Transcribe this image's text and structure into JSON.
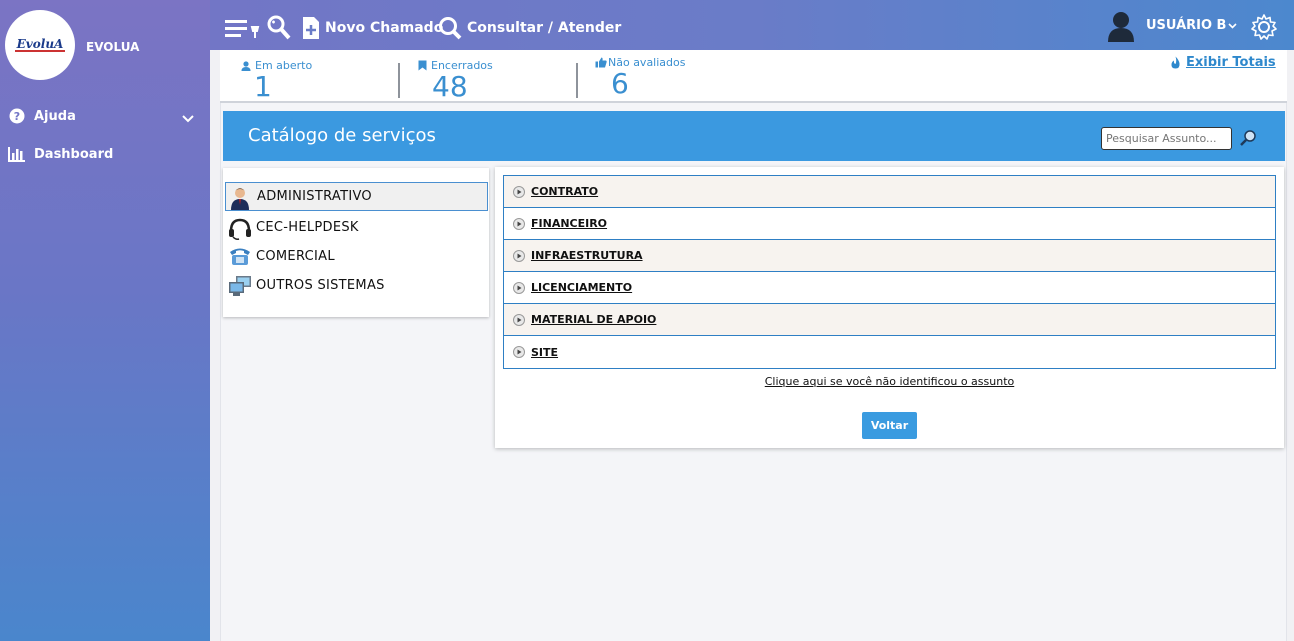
{
  "brand": {
    "logo_text": "EvoluA",
    "name": "EVOLUA"
  },
  "sidebar": {
    "items": [
      {
        "label": "Ajuda",
        "icon": "question-circle-icon"
      },
      {
        "label": "Dashboard",
        "icon": "bar-chart-icon"
      }
    ]
  },
  "topbar": {
    "novo_chamado": "Novo Chamado",
    "consultar": "Consultar / Atender",
    "user": "USUÁRIO B"
  },
  "stats": {
    "em_aberto": {
      "label": "Em aberto",
      "value": "1"
    },
    "encerrados": {
      "label": "Encerrados",
      "value": "48"
    },
    "nao_avaliados": {
      "label": "Não avaliados",
      "value": "6"
    },
    "exibir_totais": "Exibir Totais"
  },
  "catalog": {
    "title": "Catálogo de serviços",
    "search_placeholder": "Pesquisar Assunto...",
    "categories": [
      {
        "label": "ADMINISTRATIVO",
        "icon": "businessman-icon",
        "selected": true
      },
      {
        "label": "CEC-HELPDESK",
        "icon": "headset-icon",
        "selected": false
      },
      {
        "label": "COMERCIAL",
        "icon": "telephone-icon",
        "selected": false
      },
      {
        "label": "OUTROS SISTEMAS",
        "icon": "computers-icon",
        "selected": false
      }
    ],
    "subjects": [
      "CONTRATO",
      "FINANCEIRO",
      "INFRAESTRUTURA",
      "LICENCIAMENTO",
      "MATERIAL DE APOIO",
      "SITE"
    ],
    "not_found_link": "Clique aqui se você não identificou o assunto",
    "back_button": "Voltar"
  },
  "colors": {
    "accent": "#3b99e0",
    "link": "#2e88cc",
    "sidebar_top": "#7b74c4",
    "sidebar_bottom": "#4a86cc"
  }
}
